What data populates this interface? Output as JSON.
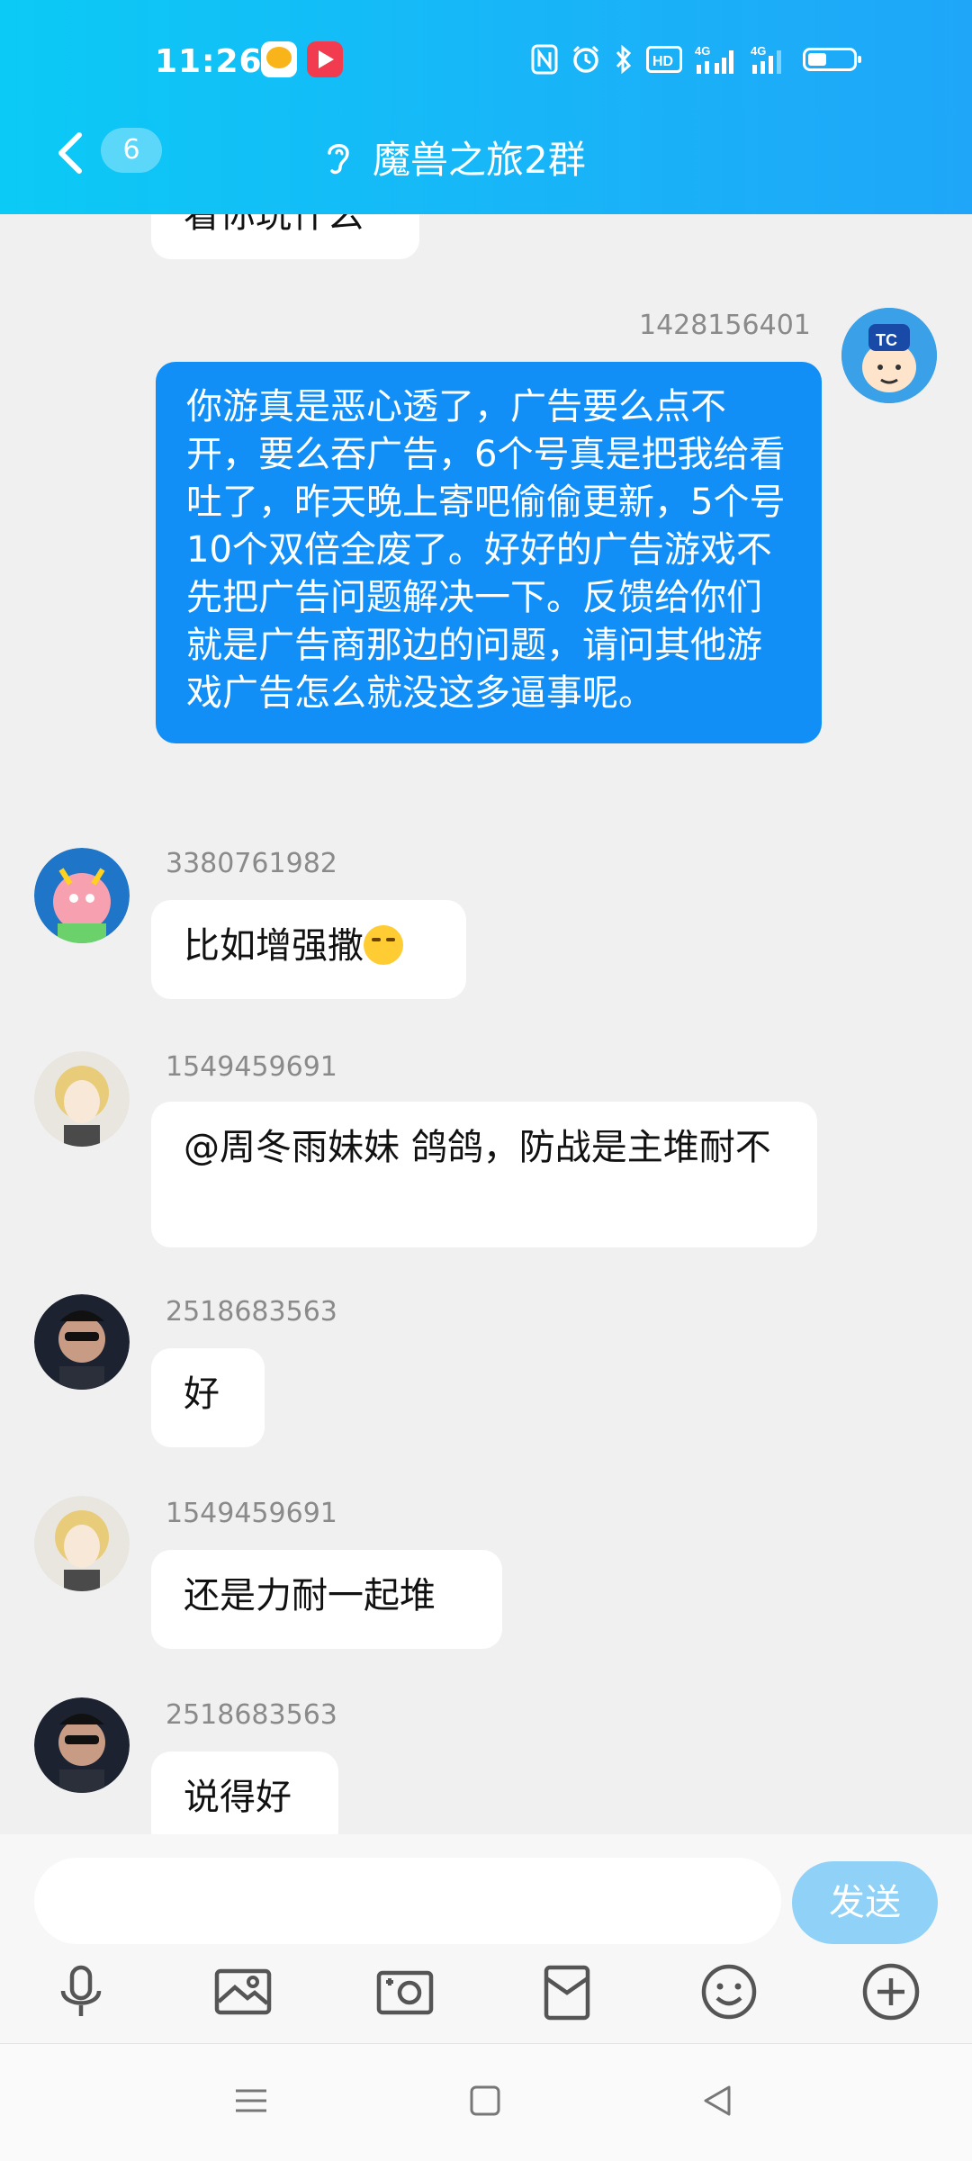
{
  "status_bar": {
    "time": "11:26",
    "icons": [
      "nfc-icon",
      "alarm-icon",
      "bluetooth-icon",
      "hd-icon",
      "signal-4g-icon",
      "signal-4g-icon",
      "battery-icon"
    ]
  },
  "header": {
    "badge_count": "6",
    "title": "魔兽之旅2群"
  },
  "messages": [
    {
      "sender": "",
      "text": "看你玩什么",
      "side": "left"
    },
    {
      "sender": "1428156401",
      "text": "你游真是恶心透了，广告要么点不开，要么吞广告，6个号真是把我给看吐了，昨天晚上寄吧偷偷更新，5个号10个双倍全废了。好好的广告游戏不先把广告问题解决一下。反馈给你们就是广告商那边的问题，请问其他游戏广告怎么就没这多逼事呢。",
      "side": "right"
    },
    {
      "sender": "3380761982",
      "text": "比如增强撒",
      "side": "left"
    },
    {
      "sender": "1549459691",
      "text": "@周冬雨妹妹 鸽鸽，防战是主堆耐不",
      "side": "left"
    },
    {
      "sender": "2518683563",
      "text": "好",
      "side": "left"
    },
    {
      "sender": "1549459691",
      "text": "还是力耐一起堆",
      "side": "left"
    },
    {
      "sender": "2518683563",
      "text": "说得好",
      "side": "left"
    }
  ],
  "input": {
    "placeholder": "",
    "send_label": "发送"
  },
  "colors": {
    "header": "#18b5f8",
    "my_bubble": "#118ff6",
    "send_button": "#8fd1f7"
  }
}
